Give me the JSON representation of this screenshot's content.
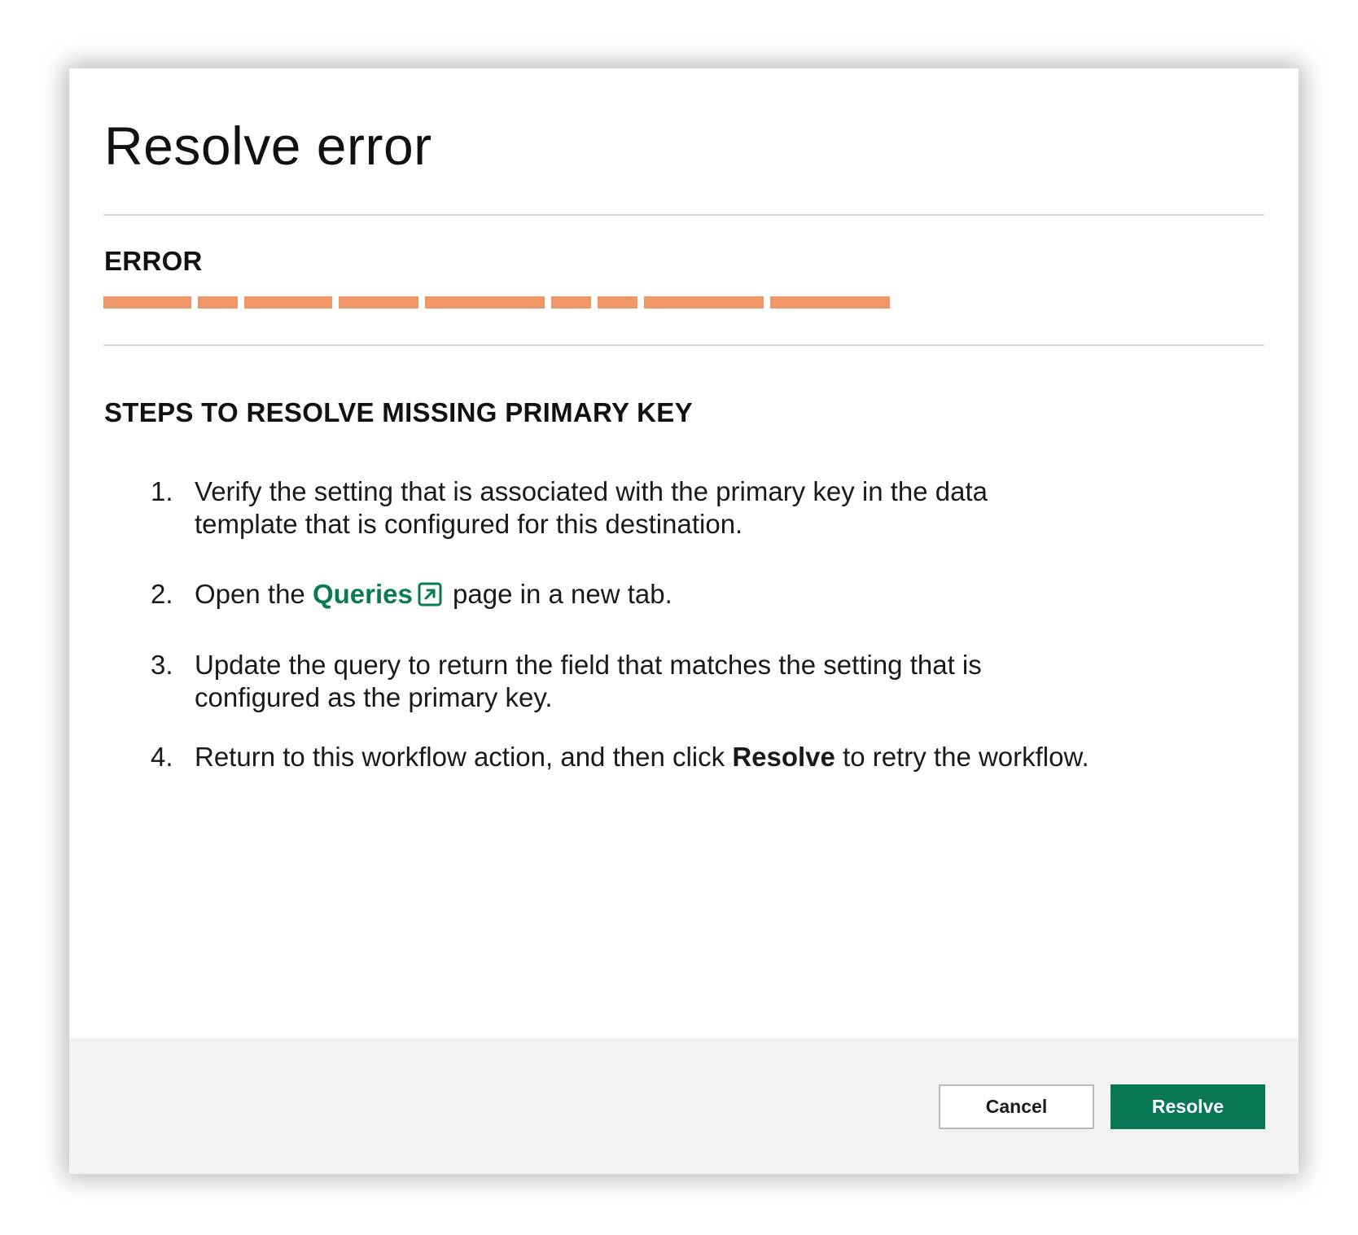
{
  "dialog": {
    "title": "Resolve error",
    "error_label": "ERROR",
    "error_message_redacted": true,
    "redaction_color": "#ef9766",
    "steps_heading": "STEPS TO RESOLVE MISSING PRIMARY KEY",
    "steps": [
      {
        "number": "1.",
        "text": "Verify the setting that is associated with the primary key in the data template that is configured for this destination."
      },
      {
        "number": "2.",
        "text_before": "Open the",
        "link_text": "Queries",
        "link_icon": "external-link-icon",
        "text_after": "page in a new tab."
      },
      {
        "number": "3.",
        "text": "Update the query to return the field that matches the setting that is configured as the primary key."
      },
      {
        "number": "4.",
        "text_before": "Return to this workflow action, and then click",
        "bold_text": "Resolve",
        "text_after": "to retry the workflow."
      }
    ]
  },
  "footer": {
    "cancel_label": "Cancel",
    "resolve_label": "Resolve"
  },
  "colors": {
    "link": "#0a7a52",
    "primary_button": "#087755",
    "footer_background": "#f1f2f1"
  }
}
